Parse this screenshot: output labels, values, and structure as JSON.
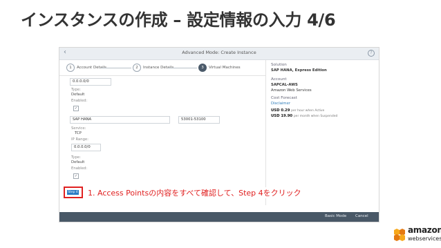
{
  "slide": {
    "title": "インスタンスの作成 – 設定情報の入力 4/6",
    "instruction": "1. Access Pointsの内容をすべて確認して、Step 4をクリック"
  },
  "app": {
    "back_icon": "chevron-left-icon",
    "window_title": "Advanced Mode: Create Instance",
    "help_icon": "question-circle-icon"
  },
  "steps": [
    {
      "num": "1",
      "label": "Account Details",
      "active": false
    },
    {
      "num": "2",
      "label": "Instance Details",
      "active": false
    },
    {
      "num": "3",
      "label": "Virtual Machines",
      "active": true
    }
  ],
  "form": {
    "ip1": "0.0.0.0/0",
    "type_label": "Type:",
    "type_value": "Default",
    "enabled_label": "Enabled:",
    "enabled_check": "✓",
    "service_name": "SAP HANA",
    "port_range": "53001-53100",
    "service_label": "Service:",
    "service_value": "TCP",
    "iprange_label": "IP Range:",
    "ip2": "0.0.0.0/0",
    "type2_label": "Type:",
    "type2_value": "Default",
    "enabled2_label": "Enabled:",
    "enabled2_check": "✓",
    "step4_button": "Step 4"
  },
  "summary": {
    "solution_label": "Solution",
    "solution_value": "SAP HANA, Express Edition",
    "account_label": "Account",
    "account_value": "SAPCAL-AWS",
    "account_provider": "Amazon Web Services",
    "cost_label": "Cost Forecast",
    "disclaimer": "Disclaimer",
    "price_active": "USD 0.29",
    "price_active_note": "per hour when Active",
    "price_suspended": "USD 19.90",
    "price_suspended_note": "per month when Suspended"
  },
  "footer": {
    "basic_mode": "Basic Mode",
    "cancel": "Cancel"
  },
  "logo": {
    "name": "amazon",
    "sub": "webservices"
  },
  "colors": {
    "highlight": "#e02020",
    "primary_button": "#2c7cc5",
    "footer_bg": "#495867"
  }
}
